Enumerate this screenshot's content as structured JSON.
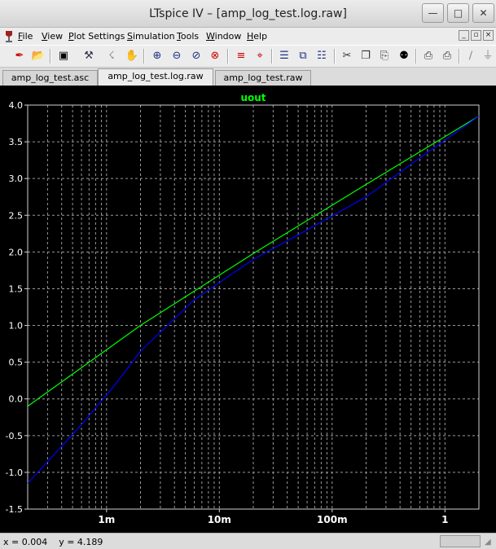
{
  "window": {
    "title": "LTspice IV – [amp_log_test.log.raw]",
    "controls": [
      "—",
      "□",
      "✕"
    ]
  },
  "menu": {
    "items": [
      {
        "label": "File",
        "key": "F",
        "rest": "ile"
      },
      {
        "label": "View",
        "key": "V",
        "rest": "iew"
      },
      {
        "label": "Plot Settings",
        "key": "P",
        "rest": "lot Settings"
      },
      {
        "label": "Simulation",
        "key": "S",
        "rest": "imulation"
      },
      {
        "label": "Tools",
        "key": "T",
        "rest": "ools"
      },
      {
        "label": "Window",
        "key": "W",
        "rest": "indow"
      },
      {
        "label": "Help",
        "key": "H",
        "rest": "elp"
      }
    ],
    "mdi_controls": [
      "_",
      "▫",
      "×"
    ]
  },
  "toolbar": {
    "icons": [
      "new-schematic-icon",
      "open-icon",
      "save-icon",
      "control-panel-icon",
      "run-icon",
      "halt-icon",
      "pan-icon",
      "zoom-in-icon",
      "zoom-out-icon",
      "zoom-fit-icon",
      "zoom-cancel-icon",
      "autorange-icon",
      "probe-icon",
      "tile-horizontal-icon",
      "cascade-icon",
      "tile-vertical-icon",
      "cut-icon",
      "copy-icon",
      "paste-icon",
      "find-icon",
      "print-preview-icon",
      "print-icon",
      "draw-wire-icon",
      "ground-icon"
    ]
  },
  "tabs": [
    {
      "label": "amp_log_test.asc",
      "active": false
    },
    {
      "label": "amp_log_test.log.raw",
      "active": true
    },
    {
      "label": "amp_log_test.raw",
      "active": false
    }
  ],
  "chart_data": {
    "type": "line",
    "title": "",
    "xlabel": "",
    "ylabel": "",
    "x_scale": "log",
    "xlim": [
      0.0002,
      2
    ],
    "ylim": [
      -1.5,
      4.0
    ],
    "grid": true,
    "legend": [
      "uout"
    ],
    "x_ticks": [
      {
        "value": 0.001,
        "label": "1m"
      },
      {
        "value": 0.01,
        "label": "10m"
      },
      {
        "value": 0.1,
        "label": "100m"
      },
      {
        "value": 1,
        "label": "1"
      }
    ],
    "y_ticks": [
      {
        "value": 4.0,
        "label": "4.0"
      },
      {
        "value": 3.5,
        "label": "3.5"
      },
      {
        "value": 3.0,
        "label": "3.0"
      },
      {
        "value": 2.5,
        "label": "2.5"
      },
      {
        "value": 2.0,
        "label": "2.0"
      },
      {
        "value": 1.5,
        "label": "1.5"
      },
      {
        "value": 1.0,
        "label": "1.0"
      },
      {
        "value": 0.5,
        "label": "0.5"
      },
      {
        "value": 0.0,
        "label": "0.0"
      },
      {
        "value": -0.5,
        "label": "-0.5"
      },
      {
        "value": -1.0,
        "label": "-1.0"
      },
      {
        "value": -1.5,
        "label": "-1.5"
      }
    ],
    "series": [
      {
        "name": "uout",
        "color": "#00ff00",
        "x": [
          0.0002,
          0.002,
          0.02,
          0.2,
          2
        ],
        "y": [
          -0.1,
          1.0,
          1.98,
          2.92,
          3.85
        ]
      },
      {
        "name": "",
        "color": "#0000ff",
        "x": [
          0.0002,
          0.0006,
          0.0012,
          0.002,
          0.006,
          0.02,
          0.06,
          0.2,
          0.6,
          2
        ],
        "y": [
          -1.15,
          -0.35,
          0.2,
          0.65,
          1.35,
          1.9,
          2.3,
          2.75,
          3.28,
          3.85
        ]
      }
    ]
  },
  "status": {
    "text": "x = 0.004    y = 4.189"
  }
}
